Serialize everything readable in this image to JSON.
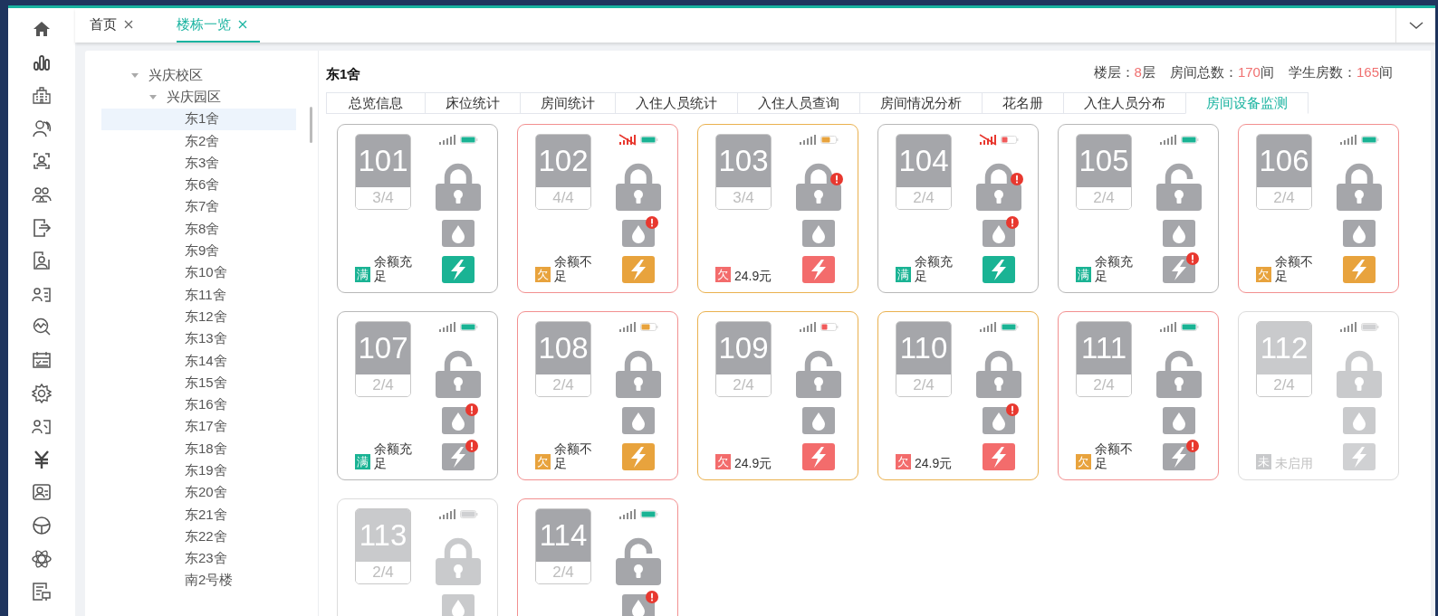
{
  "tabs": [
    {
      "label": "首页",
      "selected": false
    },
    {
      "label": "楼栋一览",
      "selected": true
    }
  ],
  "tree": [
    {
      "label": "兴庆校区",
      "expanded": true,
      "children": [
        {
          "label": "兴庆园区",
          "expanded": true,
          "children": [
            {
              "label": "东1舍",
              "selected": true
            },
            {
              "label": "东2舍",
              "selected": false
            },
            {
              "label": "东3舍",
              "selected": false
            },
            {
              "label": "东6舍",
              "selected": false
            },
            {
              "label": "东7舍",
              "selected": false
            },
            {
              "label": "东8舍",
              "selected": false
            },
            {
              "label": "东9舍",
              "selected": false
            },
            {
              "label": "东10舍",
              "selected": false
            },
            {
              "label": "东11舍",
              "selected": false
            },
            {
              "label": "东12舍",
              "selected": false
            },
            {
              "label": "东13舍",
              "selected": false
            },
            {
              "label": "东14舍",
              "selected": false
            },
            {
              "label": "东15舍",
              "selected": false
            },
            {
              "label": "东16舍",
              "selected": false
            },
            {
              "label": "东17舍",
              "selected": false
            },
            {
              "label": "东18舍",
              "selected": false
            },
            {
              "label": "东19舍",
              "selected": false
            },
            {
              "label": "东20舍",
              "selected": false
            },
            {
              "label": "东21舍",
              "selected": false
            },
            {
              "label": "东22舍",
              "selected": false
            },
            {
              "label": "东23舍",
              "selected": false
            },
            {
              "label": "南2号楼",
              "selected": false
            }
          ]
        }
      ]
    }
  ],
  "building": {
    "title": "东1舍",
    "stats": [
      {
        "label": "楼层：",
        "value": "8",
        "unit": "层"
      },
      {
        "label": "房间总数：",
        "value": "170",
        "unit": "间"
      },
      {
        "label": "学生房数：",
        "value": "165",
        "unit": "间"
      }
    ]
  },
  "sub_tabs": [
    {
      "label": "总览信息",
      "selected": false
    },
    {
      "label": "床位统计",
      "selected": false
    },
    {
      "label": "房间统计",
      "selected": false
    },
    {
      "label": "入住人员统计",
      "selected": false
    },
    {
      "label": "入住人员查询",
      "selected": false
    },
    {
      "label": "房间情况分析",
      "selected": false
    },
    {
      "label": "花名册",
      "selected": false
    },
    {
      "label": "入住人员分布",
      "selected": false
    },
    {
      "label": "房间设备监测",
      "selected": true
    }
  ],
  "cards": [
    {
      "room": "101",
      "occupancy": "3/4",
      "color": "#b8b8b8",
      "disabled": false,
      "signal_lost": false,
      "battery": {
        "color": "#1ab394"
      },
      "locked": true,
      "lock_alert": false,
      "water_alert": false,
      "power": {
        "color": "#1ab394",
        "alert": false
      },
      "badge": {
        "text": "满",
        "color": "#1ab394"
      },
      "balance": "余额充足"
    },
    {
      "room": "102",
      "occupancy": "4/4",
      "color": "#f29090",
      "disabled": false,
      "signal_lost": true,
      "battery": {
        "color": "#1ab394"
      },
      "locked": true,
      "lock_alert": false,
      "water_alert": true,
      "power": {
        "color": "#e8a33d",
        "alert": false
      },
      "badge": {
        "text": "欠",
        "color": "#e8a33d"
      },
      "balance": "余额不足"
    },
    {
      "room": "103",
      "occupancy": "3/4",
      "color": "#eab14f",
      "disabled": false,
      "signal_lost": false,
      "battery": {
        "color": "#e8a33d"
      },
      "locked": true,
      "lock_alert": true,
      "water_alert": false,
      "power": {
        "color": "#f36c6c",
        "alert": false
      },
      "badge": {
        "text": "欠",
        "color": "#f36c6c"
      },
      "balance": "24.9元"
    },
    {
      "room": "104",
      "occupancy": "2/4",
      "color": "#b8b8b8",
      "disabled": false,
      "signal_lost": true,
      "battery": {
        "color": "#f05a5a"
      },
      "locked": true,
      "lock_alert": true,
      "water_alert": true,
      "power": {
        "color": "#1ab394",
        "alert": false
      },
      "badge": {
        "text": "满",
        "color": "#1ab394"
      },
      "balance": "余额充足"
    },
    {
      "room": "105",
      "occupancy": "2/4",
      "color": "#b8b8b8",
      "disabled": false,
      "signal_lost": false,
      "battery": {
        "color": "#1ab394"
      },
      "locked": false,
      "lock_alert": false,
      "water_alert": false,
      "power": {
        "color": "#a5a6aa",
        "alert": true
      },
      "badge": {
        "text": "满",
        "color": "#1ab394"
      },
      "balance": "余额充足"
    },
    {
      "room": "106",
      "occupancy": "2/4",
      "color": "#f29090",
      "disabled": false,
      "signal_lost": false,
      "battery": {
        "color": "#1ab394"
      },
      "locked": true,
      "lock_alert": false,
      "water_alert": false,
      "power": {
        "color": "#e8a33d",
        "alert": false
      },
      "badge": {
        "text": "欠",
        "color": "#e8a33d"
      },
      "balance": "余额不足"
    },
    {
      "room": "107",
      "occupancy": "2/4",
      "color": "#b8b8b8",
      "disabled": false,
      "signal_lost": false,
      "battery": {
        "color": "#1ab394"
      },
      "locked": false,
      "lock_alert": false,
      "water_alert": true,
      "power": {
        "color": "#a5a6aa",
        "alert": true
      },
      "badge": {
        "text": "满",
        "color": "#1ab394"
      },
      "balance": "余额充足"
    },
    {
      "room": "108",
      "occupancy": "2/4",
      "color": "#f29090",
      "disabled": false,
      "signal_lost": false,
      "battery": {
        "color": "#e8a33d"
      },
      "locked": true,
      "lock_alert": false,
      "water_alert": false,
      "power": {
        "color": "#e8a33d",
        "alert": false
      },
      "badge": {
        "text": "欠",
        "color": "#e8a33d"
      },
      "balance": "余额不足"
    },
    {
      "room": "109",
      "occupancy": "2/4",
      "color": "#eab14f",
      "disabled": false,
      "signal_lost": false,
      "battery": {
        "color": "#f05a5a"
      },
      "locked": false,
      "lock_alert": false,
      "water_alert": false,
      "power": {
        "color": "#f36c6c",
        "alert": false
      },
      "badge": {
        "text": "欠",
        "color": "#f36c6c"
      },
      "balance": "24.9元"
    },
    {
      "room": "110",
      "occupancy": "2/4",
      "color": "#eab14f",
      "disabled": false,
      "signal_lost": false,
      "battery": {
        "color": "#1ab394"
      },
      "locked": true,
      "lock_alert": false,
      "water_alert": true,
      "power": {
        "color": "#f36c6c",
        "alert": false
      },
      "badge": {
        "text": "欠",
        "color": "#f36c6c"
      },
      "balance": "24.9元"
    },
    {
      "room": "111",
      "occupancy": "2/4",
      "color": "#f29090",
      "disabled": false,
      "signal_lost": false,
      "battery": {
        "color": "#1ab394"
      },
      "locked": false,
      "lock_alert": false,
      "water_alert": false,
      "power": {
        "color": "#a5a6aa",
        "alert": true
      },
      "badge": {
        "text": "欠",
        "color": "#e8a33d"
      },
      "balance": "余额不足"
    },
    {
      "room": "112",
      "occupancy": "2/4",
      "color": "#dcdcdc",
      "disabled": true,
      "signal_lost": false,
      "battery": {
        "color": "#cfd0d2"
      },
      "locked": true,
      "lock_alert": false,
      "water_alert": false,
      "power": {
        "color": "#d0d1d3",
        "alert": false
      },
      "badge": {
        "text": "未",
        "color": "#c8c9cb"
      },
      "balance": "未启用"
    },
    {
      "room": "113",
      "occupancy": "2/4",
      "color": "#dcdcdc",
      "disabled": true,
      "signal_lost": false,
      "battery": {
        "color": "#cfd0d2"
      },
      "locked": true,
      "lock_alert": false,
      "water_alert": false
    },
    {
      "room": "114",
      "occupancy": "2/4",
      "color": "#f29090",
      "disabled": false,
      "signal_lost": false,
      "battery": {
        "color": "#1ab394"
      },
      "locked": false,
      "lock_alert": false,
      "water_alert": true
    }
  ]
}
